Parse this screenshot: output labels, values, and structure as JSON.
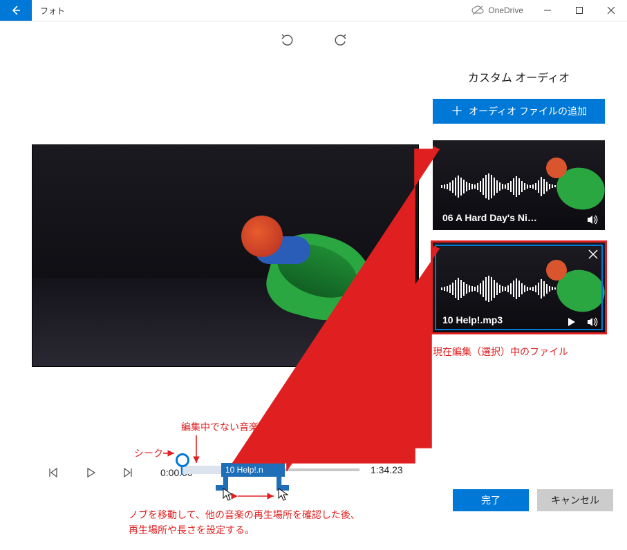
{
  "titlebar": {
    "app_name": "フォト",
    "onedrive_label": "OneDrive"
  },
  "side": {
    "heading": "カスタム オーディオ",
    "add_button": "オーディオ ファイルの追加"
  },
  "audio_files": [
    {
      "title": "06 A Hard Day's Ni…"
    },
    {
      "title": "10 Help!.mp3"
    }
  ],
  "annotations": {
    "selected_file": "現在編集（選択）中のファイル",
    "other_music_playhead": "編集中でない音楽の再生場所",
    "seek_label": "シーク",
    "knob_help_1": "ノブを移動して、他の音楽の再生場所を確認した後、",
    "knob_help_2": "再生場所や長さを設定する。"
  },
  "playback": {
    "current_time": "0:00.00",
    "total_time": "1:34.23",
    "clip_label": "10 Help!.n"
  },
  "buttons": {
    "done": "完了",
    "cancel": "キャンセル"
  }
}
